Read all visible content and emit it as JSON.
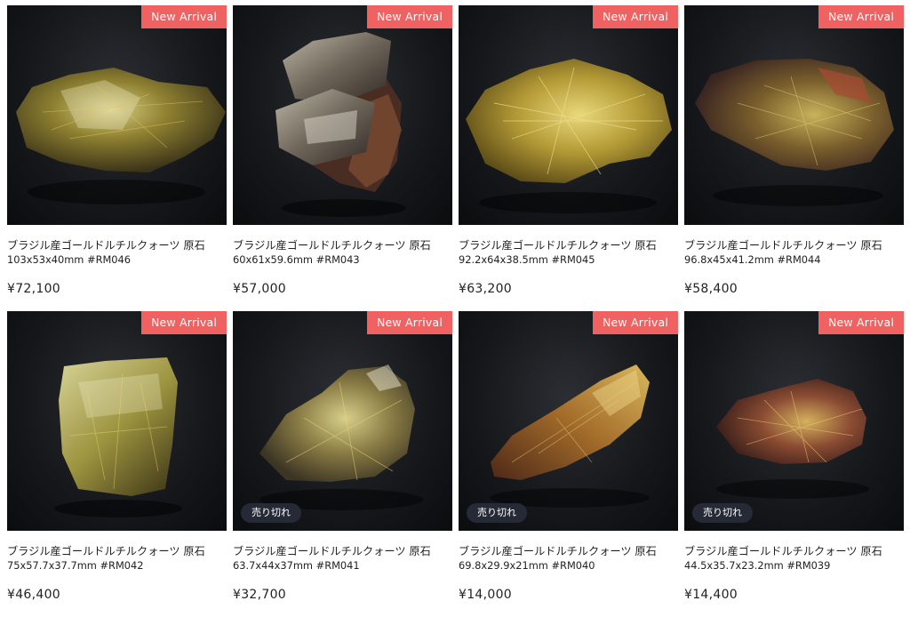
{
  "products": [
    {
      "badge": "New Arrival",
      "title": "ブラジル産ゴールドルチルクォーツ 原石",
      "spec": "103x53x40mm #RM046",
      "price": "¥72,100",
      "sold": "",
      "stone": "crystal-olive"
    },
    {
      "badge": "New Arrival",
      "title": "ブラジル産ゴールドルチルクォーツ 原石",
      "spec": "60x61x59.6mm #RM043",
      "price": "¥57,000",
      "sold": "",
      "stone": "crystal-smoky-cluster"
    },
    {
      "badge": "New Arrival",
      "title": "ブラジル産ゴールドルチルクォーツ 原石",
      "spec": "92.2x64x38.5mm #RM045",
      "price": "¥63,200",
      "sold": "",
      "stone": "crystal-golden"
    },
    {
      "badge": "New Arrival",
      "title": "ブラジル産ゴールドルチルクォーツ 原石",
      "spec": "96.8x45x41.2mm #RM044",
      "price": "¥58,400",
      "sold": "",
      "stone": "crystal-brown-gold"
    },
    {
      "badge": "New Arrival",
      "title": "ブラジル産ゴールドルチルクォーツ 原石",
      "spec": "75x57.7x37.7mm #RM042",
      "price": "¥46,400",
      "sold": "",
      "stone": "crystal-pale-yellow"
    },
    {
      "badge": "New Arrival",
      "title": "ブラジル産ゴールドルチルクォーツ 原石",
      "spec": "63.7x44x37mm #RM041",
      "price": "¥32,700",
      "sold": "売り切れ",
      "stone": "crystal-smoky-gold"
    },
    {
      "badge": "New Arrival",
      "title": "ブラジル産ゴールドルチルクォーツ 原石",
      "spec": "69.8x29.9x21mm #RM040",
      "price": "¥14,000",
      "sold": "売り切れ",
      "stone": "crystal-amber"
    },
    {
      "badge": "New Arrival",
      "title": "ブラジル産ゴールドルチルクォーツ 原石",
      "spec": "44.5x35.7x23.2mm #RM039",
      "price": "¥14,400",
      "sold": "売り切れ",
      "stone": "crystal-red-gold"
    }
  ]
}
